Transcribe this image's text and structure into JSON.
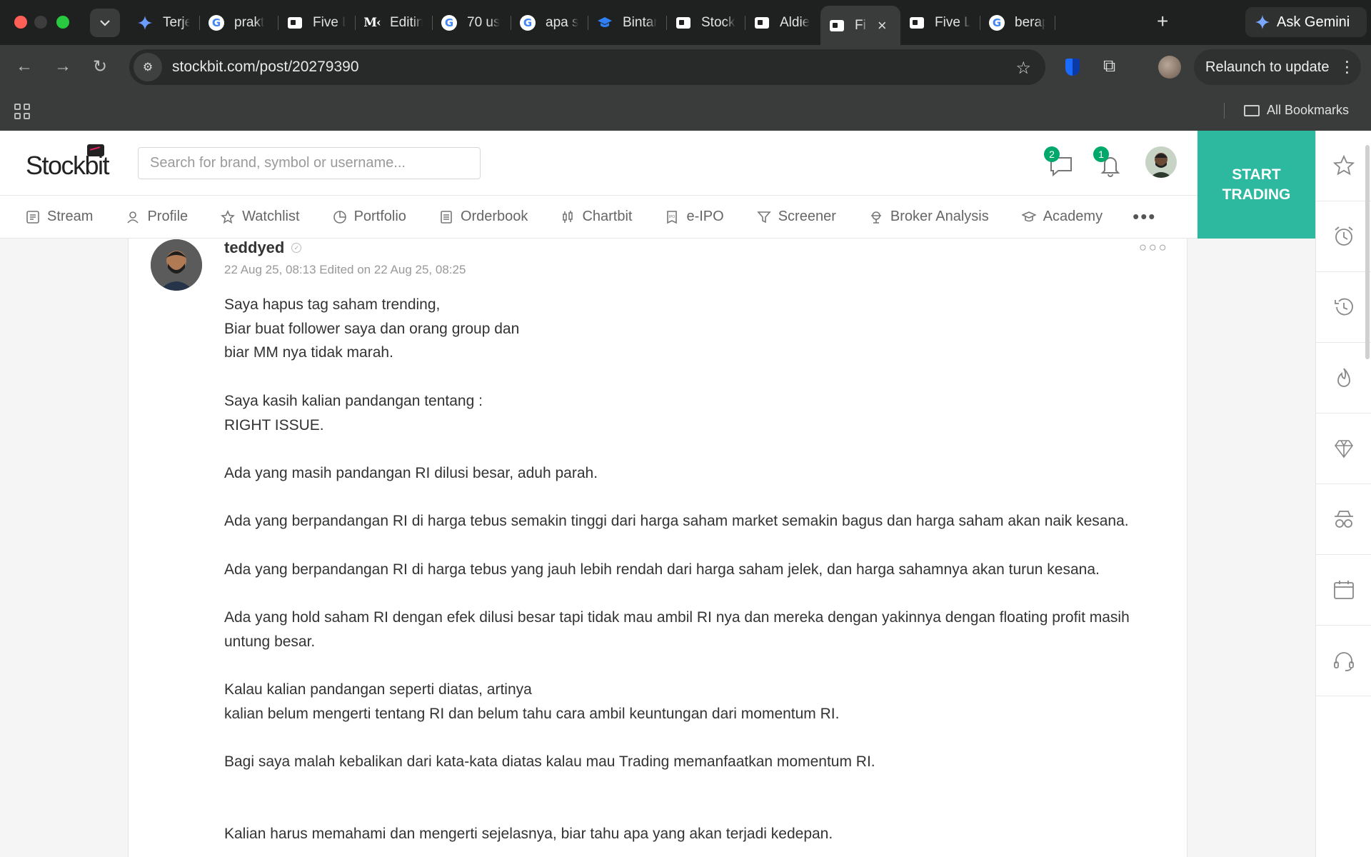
{
  "browser": {
    "tabs": [
      {
        "label": "Terjen",
        "favicon": "gemini-icon"
      },
      {
        "label": "prakt",
        "favicon": "google-icon"
      },
      {
        "label": "Five L",
        "favicon": "stockbit-icon"
      },
      {
        "label": "Editin",
        "favicon": "medium-icon"
      },
      {
        "label": "70 us",
        "favicon": "google-icon"
      },
      {
        "label": "apa s",
        "favicon": "google-icon"
      },
      {
        "label": "Bintar",
        "favicon": "graduation-cap-icon"
      },
      {
        "label": "Stock",
        "favicon": "stockbit-icon"
      },
      {
        "label": "Aldie",
        "favicon": "stockbit-icon"
      },
      {
        "label": "Fi",
        "favicon": "stockbit-icon",
        "active": true
      },
      {
        "label": "Five L",
        "favicon": "stockbit-icon"
      },
      {
        "label": "berap",
        "favicon": "google-icon"
      }
    ],
    "gemini_label": "Ask Gemini",
    "url": "stockbit.com/post/20279390",
    "relaunch_label": "Relaunch to update",
    "bookmarks_label": "All Bookmarks"
  },
  "header": {
    "logo": "Stockbit",
    "search_placeholder": "Search for brand, symbol or username...",
    "messages_badge": "2",
    "notifications_badge": "1",
    "start_trading": "START TRADING"
  },
  "nav": {
    "items": [
      {
        "label": "Stream",
        "icon": "stream-icon"
      },
      {
        "label": "Profile",
        "icon": "profile-icon"
      },
      {
        "label": "Watchlist",
        "icon": "star-icon"
      },
      {
        "label": "Portfolio",
        "icon": "pie-icon"
      },
      {
        "label": "Orderbook",
        "icon": "orderbook-icon"
      },
      {
        "label": "Chartbit",
        "icon": "candlestick-icon"
      },
      {
        "label": "e-IPO",
        "icon": "ipo-icon"
      },
      {
        "label": "Screener",
        "icon": "filter-icon"
      },
      {
        "label": "Broker Analysis",
        "icon": "broker-icon"
      },
      {
        "label": "Academy",
        "icon": "academy-icon"
      }
    ],
    "more": "•••"
  },
  "rail": [
    "star-icon",
    "alarm-icon",
    "history-icon",
    "fire-icon",
    "diamond-icon",
    "spy-icon",
    "calendar-icon",
    "headset-icon"
  ],
  "post": {
    "author": "teddyed",
    "meta": "22 Aug 25, 08:13 Edited on 22 Aug 25, 08:25",
    "lines": [
      "Saya hapus tag saham trending,",
      "Biar buat follower saya dan orang group dan",
      "biar MM nya tidak marah.",
      "",
      "Saya kasih kalian pandangan tentang :",
      "RIGHT ISSUE.",
      "",
      "Ada yang masih pandangan RI dilusi besar, aduh parah.",
      "",
      "Ada yang berpandangan RI di harga tebus semakin tinggi dari harga saham market semakin bagus dan harga saham akan naik kesana.",
      "",
      "Ada yang berpandangan RI di harga tebus yang jauh lebih rendah dari harga saham jelek, dan harga sahamnya akan turun kesana.",
      "",
      "Ada yang hold saham RI dengan efek dilusi besar tapi tidak mau ambil RI nya dan mereka dengan yakinnya dengan floating profit masih untung besar.",
      "",
      "Kalau kalian pandangan seperti diatas, artinya",
      "kalian belum mengerti tentang RI dan belum tahu cara ambil keuntungan dari momentum RI.",
      "",
      "Bagi saya malah kebalikan dari kata-kata diatas kalau mau Trading memanfaatkan momentum RI.",
      "",
      "",
      "Kalian harus memahami dan mengerti sejelasnya, biar tahu apa yang akan terjadi kedepan."
    ]
  }
}
